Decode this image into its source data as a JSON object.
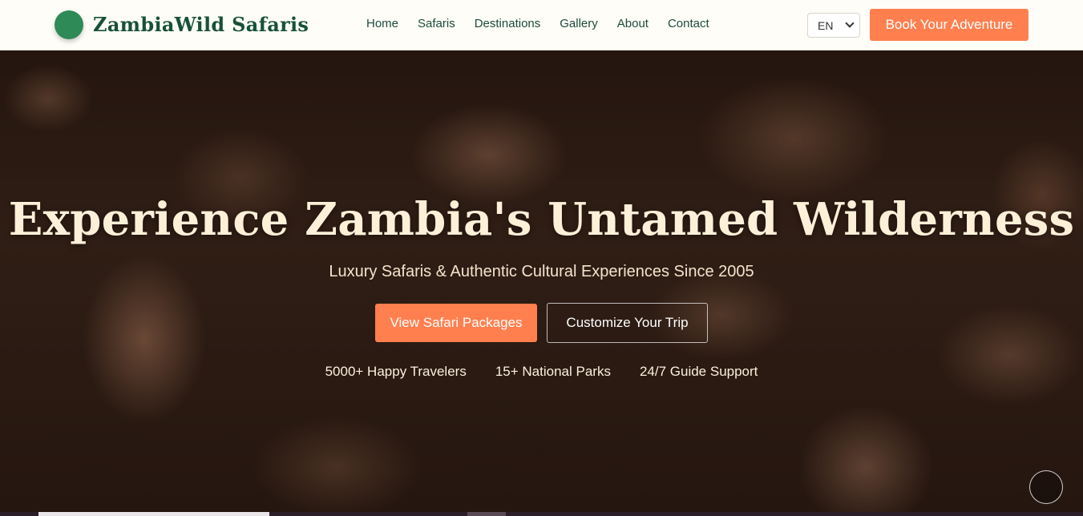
{
  "header": {
    "brand": "ZambiaWild Safaris",
    "nav": [
      "Home",
      "Safaris",
      "Destinations",
      "Gallery",
      "About",
      "Contact"
    ],
    "language": "EN",
    "cta": "Book Your Adventure"
  },
  "hero": {
    "title": "Experience Zambia's Untamed Wilderness",
    "subtitle": "Luxury Safaris & Authentic Cultural Experiences Since 2005",
    "primary_button": "View Safari Packages",
    "secondary_button": "Customize Your Trip",
    "stats": [
      "5000+ Happy Travelers",
      "15+ National Parks",
      "24/7 Guide Support"
    ]
  },
  "colors": {
    "accent": "#ff7f4f",
    "brand_green": "#2e8a57",
    "brand_text": "#17513a"
  }
}
